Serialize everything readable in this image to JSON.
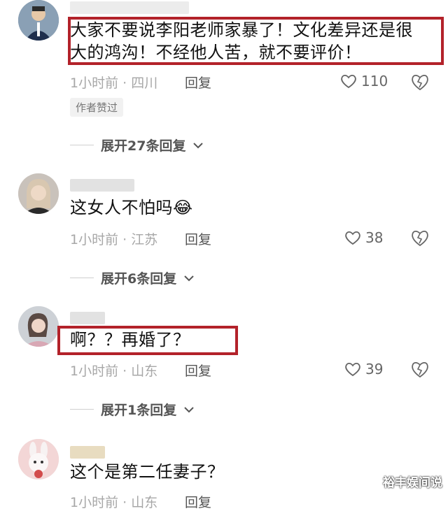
{
  "comments": [
    {
      "text_lines": [
        "大家不要说李阳老师家暴了！文化差异还是很",
        "大的鸿沟！不经他人苦，就不要评价！"
      ],
      "time_location": "1小时前 · 四川",
      "reply_label": "回复",
      "likes": "110",
      "badge": "作者赞过",
      "expand_label": "展开27条回复"
    },
    {
      "text": "这女人不怕吗",
      "emoji": "😂",
      "time_location": "1小时前 · 江苏",
      "reply_label": "回复",
      "likes": "38",
      "expand_label": "展开6条回复"
    },
    {
      "text": "啊？？再婚了？",
      "time_location": "1小时前 · 山东",
      "reply_label": "回复",
      "likes": "39",
      "expand_label": "展开1条回复"
    },
    {
      "text": "这个是第二任妻子？",
      "time_location": "1小时前 · 山东",
      "reply_label": "回复"
    }
  ],
  "watermark": "裕丰娱间说",
  "colors": {
    "highlight": "#b3222a",
    "meta": "#a7a7a7"
  }
}
